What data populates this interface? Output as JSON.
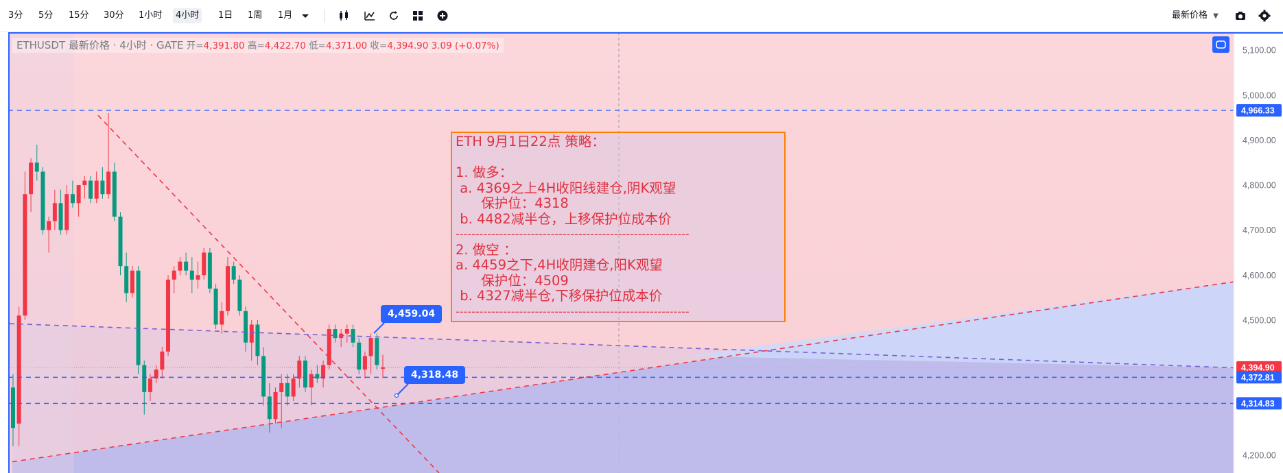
{
  "toolbar": {
    "timeframes": [
      "3分",
      "5分",
      "15分",
      "30分",
      "1小时",
      "4小时",
      "1日",
      "1周",
      "1月"
    ],
    "active_timeframe": "4小时",
    "price_type": "最新价格"
  },
  "legend": {
    "symbol": "ETHUSDT 最新价格 · 4小时 · GATE",
    "open_label": "开=",
    "open": "4,391.80",
    "high_label": "高=",
    "high": "4,422.70",
    "low_label": "低=",
    "low": "4,371.00",
    "close_label": "收=",
    "close": "4,394.90",
    "change": "3.09 (+0.07%)"
  },
  "note": {
    "lines": [
      "ETH 9月1日22点 策略：",
      "",
      "1. 做多：",
      " a. 4369之上4H收阳线建仓,阴K观望",
      "      保护位：4318",
      " b. 4482减半仓，上移保护位成本价",
      "2. 做空 ：",
      "a. 4459之下,4H收阴建仓,阳K观望",
      "      保护位：4509",
      " b. 4327减半仓,下移保护位成本价"
    ],
    "separator": "-----------------------------------------------------------"
  },
  "callouts": {
    "upper": "4,459.04",
    "lower": "4,318.48"
  },
  "colors": {
    "up": "#f23645",
    "down": "#089981",
    "accent": "#2962ff",
    "note_border": "#ff7f00",
    "zone_top": "#f9d3d8",
    "zone_bottom": "#b5b8ee"
  },
  "chart_data": {
    "type": "candlestick",
    "symbol": "ETHUSDT",
    "interval": "4小时",
    "exchange": "GATE",
    "ylim": [
      4160,
      5140
    ],
    "y_ticks": [
      4200,
      4300,
      4400,
      4500,
      4600,
      4700,
      4800,
      4900,
      5000,
      5100
    ],
    "y_tick_labels": [
      "4,200.00",
      "",
      "",
      "4,500.00",
      "4,600.00",
      "4,700.00",
      "4,800.00",
      "4,900.00",
      "5,000.00",
      "5,100.00"
    ],
    "price_tags": [
      {
        "value": 4966.33,
        "label": "4,966.33",
        "color": "#2962ff"
      },
      {
        "value": 4394.9,
        "label": "4,394.90",
        "color": "#f23645"
      },
      {
        "value": 4372.81,
        "label": "4,372.81",
        "color": "#2962ff"
      },
      {
        "value": 4314.83,
        "label": "4,314.83",
        "color": "#2962ff"
      }
    ],
    "horizontal_levels": [
      4966.33,
      4372.81,
      4314.83
    ],
    "current_price": 4394.9,
    "candles": [
      [
        4350,
        4380,
        4220,
        4260
      ],
      [
        4270,
        4530,
        4220,
        4510
      ],
      [
        4510,
        4830,
        4500,
        4780
      ],
      [
        4780,
        4860,
        4740,
        4850
      ],
      [
        4850,
        4890,
        4810,
        4830
      ],
      [
        4830,
        4840,
        4690,
        4700
      ],
      [
        4700,
        4730,
        4650,
        4720
      ],
      [
        4720,
        4790,
        4700,
        4760
      ],
      [
        4760,
        4790,
        4690,
        4700
      ],
      [
        4700,
        4800,
        4690,
        4780
      ],
      [
        4780,
        4810,
        4750,
        4760
      ],
      [
        4760,
        4800,
        4730,
        4800
      ],
      [
        4800,
        4820,
        4770,
        4810
      ],
      [
        4810,
        4820,
        4760,
        4770
      ],
      [
        4770,
        4830,
        4760,
        4810
      ],
      [
        4810,
        4840,
        4770,
        4780
      ],
      [
        4780,
        4960,
        4770,
        4830
      ],
      [
        4830,
        4850,
        4720,
        4730
      ],
      [
        4730,
        4740,
        4600,
        4620
      ],
      [
        4620,
        4650,
        4540,
        4560
      ],
      [
        4560,
        4620,
        4550,
        4610
      ],
      [
        4610,
        4620,
        4380,
        4400
      ],
      [
        4400,
        4410,
        4290,
        4340
      ],
      [
        4340,
        4380,
        4320,
        4370
      ],
      [
        4370,
        4400,
        4360,
        4390
      ],
      [
        4390,
        4440,
        4370,
        4430
      ],
      [
        4430,
        4600,
        4420,
        4590
      ],
      [
        4590,
        4620,
        4560,
        4610
      ],
      [
        4610,
        4640,
        4600,
        4630
      ],
      [
        4630,
        4650,
        4600,
        4610
      ],
      [
        4610,
        4640,
        4560,
        4590
      ],
      [
        4590,
        4630,
        4570,
        4600
      ],
      [
        4600,
        4660,
        4590,
        4650
      ],
      [
        4650,
        4660,
        4560,
        4570
      ],
      [
        4570,
        4580,
        4480,
        4490
      ],
      [
        4490,
        4540,
        4470,
        4520
      ],
      [
        4520,
        4640,
        4510,
        4620
      ],
      [
        4620,
        4630,
        4580,
        4590
      ],
      [
        4590,
        4600,
        4510,
        4520
      ],
      [
        4520,
        4530,
        4430,
        4450
      ],
      [
        4450,
        4500,
        4410,
        4490
      ],
      [
        4490,
        4500,
        4400,
        4420
      ],
      [
        4420,
        4440,
        4310,
        4330
      ],
      [
        4330,
        4360,
        4250,
        4280
      ],
      [
        4280,
        4350,
        4270,
        4340
      ],
      [
        4340,
        4380,
        4260,
        4360
      ],
      [
        4360,
        4380,
        4310,
        4330
      ],
      [
        4330,
        4380,
        4320,
        4370
      ],
      [
        4370,
        4420,
        4350,
        4410
      ],
      [
        4410,
        4420,
        4340,
        4350
      ],
      [
        4350,
        4390,
        4310,
        4380
      ],
      [
        4380,
        4400,
        4360,
        4370
      ],
      [
        4370,
        4410,
        4350,
        4400
      ],
      [
        4400,
        4490,
        4390,
        4480
      ],
      [
        4480,
        4490,
        4450,
        4460
      ],
      [
        4460,
        4480,
        4440,
        4470
      ],
      [
        4470,
        4490,
        4450,
        4480
      ],
      [
        4480,
        4490,
        4440,
        4450
      ],
      [
        4450,
        4460,
        4380,
        4390
      ],
      [
        4390,
        4430,
        4370,
        4420
      ],
      [
        4420,
        4470,
        4380,
        4460
      ],
      [
        4460,
        4470,
        4390,
        4400
      ],
      [
        4391.8,
        4422.7,
        4371,
        4394.9
      ]
    ],
    "drawings": [
      {
        "type": "falling-trendline",
        "color": "#f23645"
      },
      {
        "type": "rising-trendline",
        "color": "#f23645"
      },
      {
        "type": "channel-upper-line",
        "color": "#7b5fd0"
      }
    ]
  }
}
